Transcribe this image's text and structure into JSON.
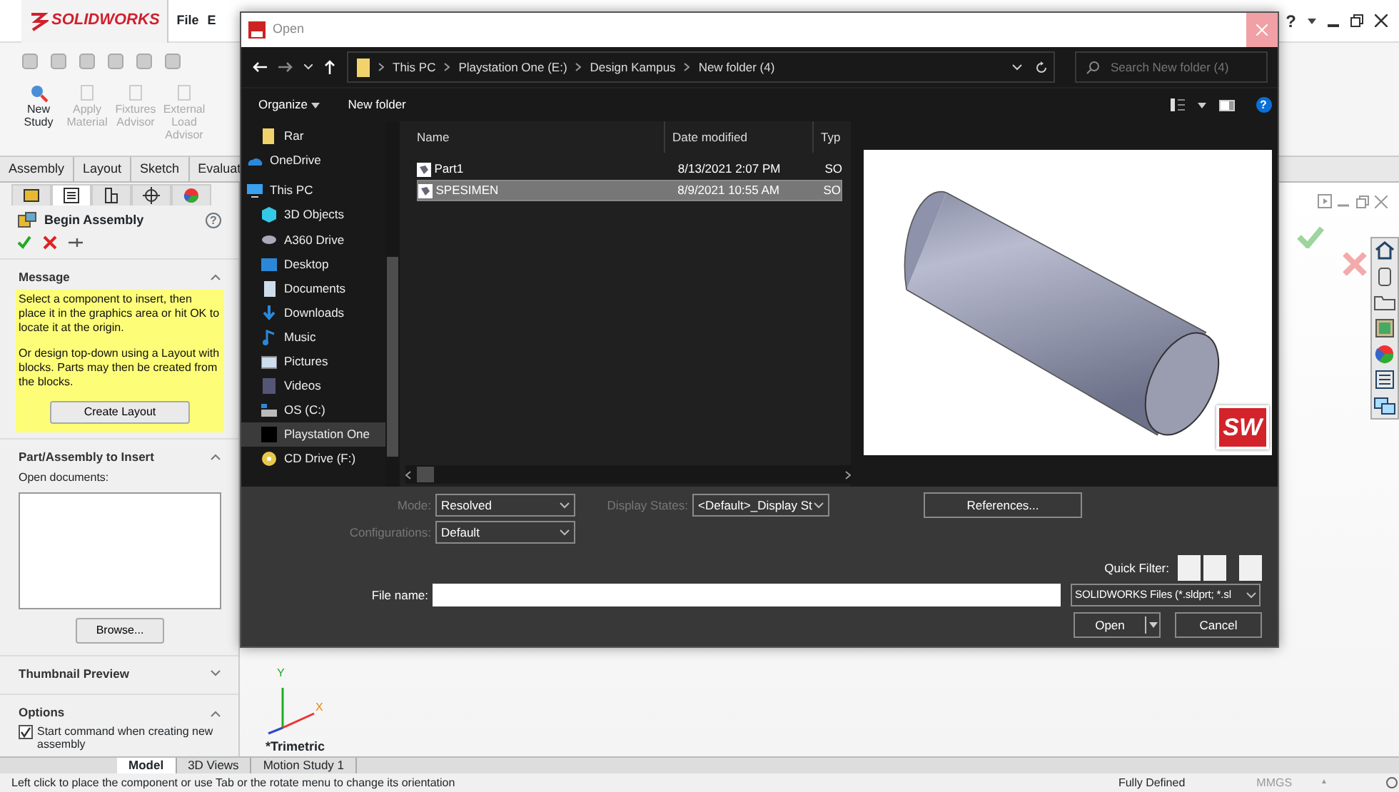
{
  "app": {
    "logo": "SOLIDWORKS",
    "menu": [
      "File",
      "E"
    ],
    "help": "?",
    "command_manager": [
      {
        "label": "New Study",
        "disabled": false
      },
      {
        "label": "Apply Material",
        "disabled": true
      },
      {
        "label": "Fixtures Advisor",
        "disabled": true
      },
      {
        "label": "External Load Advisor",
        "disabled": true
      }
    ],
    "tabs": [
      {
        "label": "Assembly",
        "selected": false
      },
      {
        "label": "Layout",
        "selected": false
      },
      {
        "label": "Sketch",
        "selected": false
      },
      {
        "label": "Evaluat",
        "selected": false
      }
    ]
  },
  "property_manager": {
    "panel_tabs": [
      {
        "selected": false
      },
      {
        "selected": true
      },
      {
        "selected": false
      },
      {
        "selected": false
      },
      {
        "selected": false
      }
    ],
    "title": "Begin Assembly",
    "help": "?",
    "sections": [
      {
        "kind": "message",
        "title": "Message",
        "expanded": true,
        "paragraphs": [
          "Select a component to insert, then place it in the graphics area or hit OK to locate it at the origin.",
          "Or design top-down using a Layout with blocks. Parts may then be created from the blocks."
        ],
        "button": "Create Layout"
      },
      {
        "kind": "insert",
        "title": "Part/Assembly to Insert",
        "expanded": true,
        "label": "Open documents:",
        "button": "Browse..."
      },
      {
        "kind": "thumbnail",
        "title": "Thumbnail Preview",
        "expanded": false
      },
      {
        "kind": "options",
        "title": "Options",
        "expanded": true,
        "checkbox": {
          "label": "Start command when creating new assembly",
          "checked": true
        }
      }
    ]
  },
  "graphics": {
    "view_label": "*Trimetric",
    "triad": {
      "y": "Y",
      "x": "X"
    }
  },
  "bottom_tabs": [
    {
      "label": "Model",
      "selected": true
    },
    {
      "label": "3D Views",
      "selected": false
    },
    {
      "label": "Motion Study 1",
      "selected": false
    }
  ],
  "status_bar": {
    "message": "Left click to place the component or use Tab or the rotate menu to change its orientation",
    "state": "Fully Defined",
    "units": "MMGS",
    "units_caret": "▲"
  },
  "dialog": {
    "title": "Open",
    "path": [
      "This PC",
      "Playstation One (E:)",
      "Design Kampus",
      "New folder (4)"
    ],
    "search_placeholder": "Search New folder (4)",
    "commands": [
      "Organize",
      "New folder"
    ],
    "help": "?",
    "nav": [
      {
        "label": "Rar",
        "selected": false
      },
      {
        "label": "OneDrive",
        "selected": false
      },
      {
        "label": "This PC",
        "selected": false
      },
      {
        "label": "3D Objects",
        "selected": false
      },
      {
        "label": "A360 Drive",
        "selected": false
      },
      {
        "label": "Desktop",
        "selected": false
      },
      {
        "label": "Documents",
        "selected": false
      },
      {
        "label": "Downloads",
        "selected": false
      },
      {
        "label": "Music",
        "selected": false
      },
      {
        "label": "Pictures",
        "selected": false
      },
      {
        "label": "Videos",
        "selected": false
      },
      {
        "label": "OS (C:)",
        "selected": false
      },
      {
        "label": "Playstation One",
        "selected": true
      },
      {
        "label": "CD Drive (F:)",
        "selected": false
      }
    ],
    "columns": [
      "Name",
      "Date modified",
      "Typ"
    ],
    "files": [
      {
        "name": "Part1",
        "date": "8/13/2021 2:07 PM",
        "type": "SO",
        "selected": false
      },
      {
        "name": "SPESIMEN",
        "date": "8/9/2021 10:55 AM",
        "type": "SO",
        "selected": true
      }
    ],
    "preview_badge": "SW",
    "mode": {
      "label": "Mode:",
      "value": "Resolved"
    },
    "display_states": {
      "label": "Display States:",
      "value": "<Default>_Display St"
    },
    "configurations": {
      "label": "Configurations:",
      "value": "Default"
    },
    "references": "References...",
    "quick_filter": "Quick Filter:",
    "file_name": {
      "label": "File name:"
    },
    "file_type": "SOLIDWORKS Files (*.sldprt; *.sl",
    "open": "Open",
    "cancel": "Cancel"
  }
}
